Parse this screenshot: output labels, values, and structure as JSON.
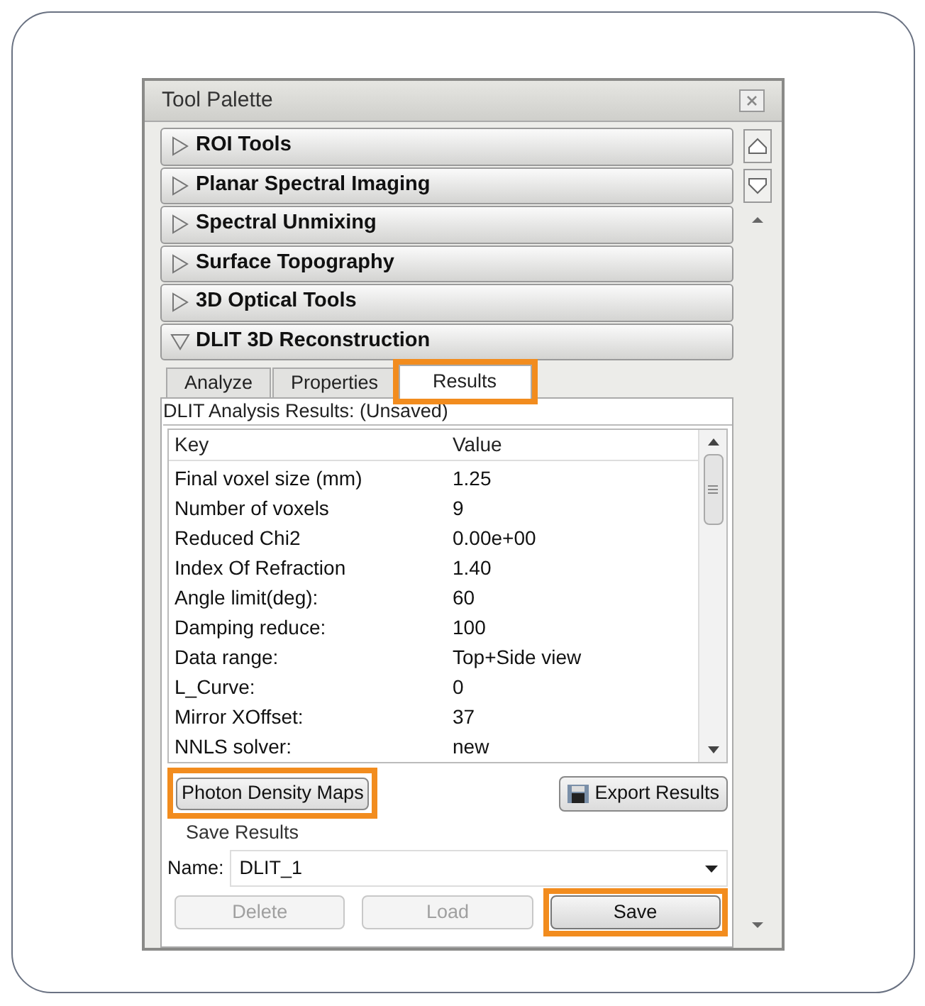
{
  "window": {
    "title": "Tool Palette"
  },
  "sections": [
    {
      "label": "ROI Tools",
      "expanded": false
    },
    {
      "label": "Planar Spectral Imaging",
      "expanded": false
    },
    {
      "label": "Spectral Unmixing",
      "expanded": false
    },
    {
      "label": "Surface Topography",
      "expanded": false
    },
    {
      "label": "3D Optical Tools",
      "expanded": false
    },
    {
      "label": "DLIT 3D Reconstruction",
      "expanded": true
    }
  ],
  "tabs": [
    {
      "label": "Analyze",
      "selected": false,
      "highlighted": false
    },
    {
      "label": "Properties",
      "selected": false,
      "highlighted": false
    },
    {
      "label": "Results",
      "selected": true,
      "highlighted": true
    }
  ],
  "results_title": "DLIT Analysis Results: (Unsaved)",
  "table": {
    "columns": [
      "Key",
      "Value"
    ],
    "rows": [
      [
        "Final voxel size (mm)",
        "1.25"
      ],
      [
        "Number of voxels",
        "9"
      ],
      [
        "Reduced Chi2",
        "0.00e+00"
      ],
      [
        "Index Of Refraction",
        "1.40"
      ],
      [
        "Angle limit(deg):",
        "60"
      ],
      [
        "Damping reduce:",
        "100"
      ],
      [
        "Data range:",
        "Top+Side view"
      ],
      [
        "L_Curve:",
        "0"
      ],
      [
        "Mirror XOffset:",
        "37"
      ],
      [
        "NNLS solver:",
        "new"
      ]
    ]
  },
  "photon_button": {
    "label": "Photon Density Maps",
    "highlighted": true
  },
  "export_button": {
    "label": "Export Results"
  },
  "save_group": {
    "title": "Save Results",
    "name_label": "Name:",
    "name_value": "DLIT_1"
  },
  "actions": [
    {
      "label": "Delete",
      "disabled": true,
      "highlighted": false
    },
    {
      "label": "Load",
      "disabled": true,
      "highlighted": false
    },
    {
      "label": "Save",
      "disabled": false,
      "highlighted": true
    }
  ]
}
